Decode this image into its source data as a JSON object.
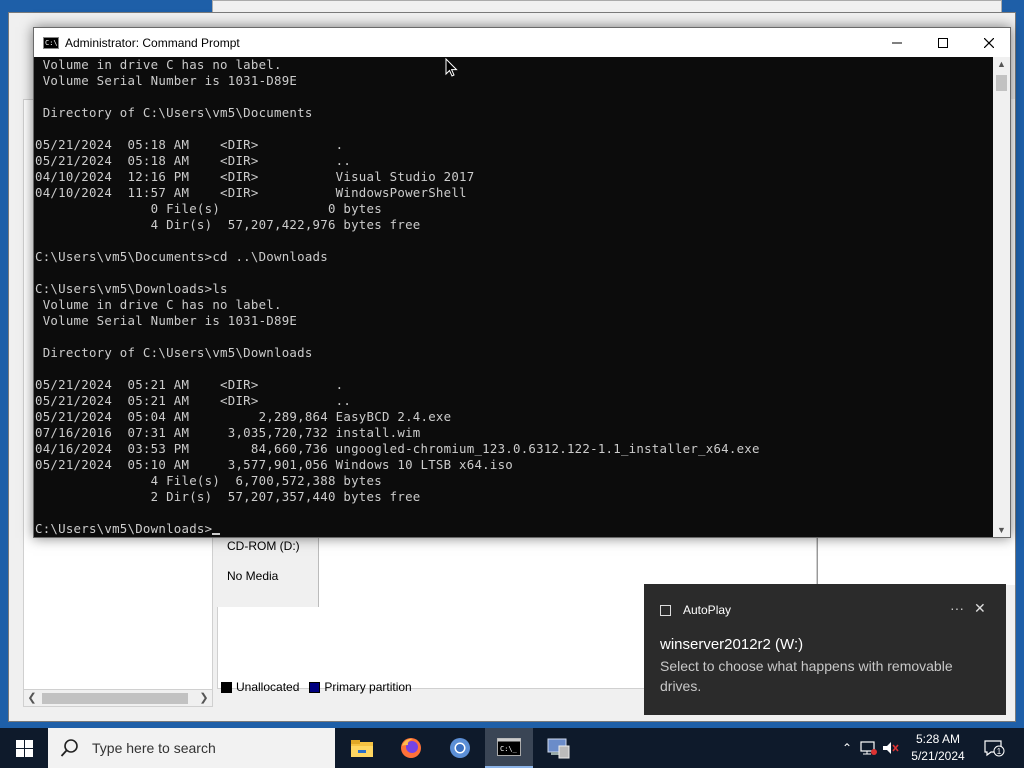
{
  "cmd": {
    "title": "Administrator: Command Prompt",
    "lines": [
      " Volume in drive C has no label.",
      " Volume Serial Number is 1031-D89E",
      "",
      " Directory of C:\\Users\\vm5\\Documents",
      "",
      "05/21/2024  05:18 AM    <DIR>          .",
      "05/21/2024  05:18 AM    <DIR>          ..",
      "04/10/2024  12:16 PM    <DIR>          Visual Studio 2017",
      "04/10/2024  11:57 AM    <DIR>          WindowsPowerShell",
      "               0 File(s)              0 bytes",
      "               4 Dir(s)  57,207,422,976 bytes free",
      "",
      "C:\\Users\\vm5\\Documents>cd ..\\Downloads",
      "",
      "C:\\Users\\vm5\\Downloads>ls",
      " Volume in drive C has no label.",
      " Volume Serial Number is 1031-D89E",
      "",
      " Directory of C:\\Users\\vm5\\Downloads",
      "",
      "05/21/2024  05:21 AM    <DIR>          .",
      "05/21/2024  05:21 AM    <DIR>          ..",
      "05/21/2024  05:04 AM         2,289,864 EasyBCD 2.4.exe",
      "07/16/2016  07:31 AM     3,035,720,732 install.wim",
      "04/16/2024  03:53 PM        84,660,736 ungoogled-chromium_123.0.6312.122-1.1_installer_x64.exe",
      "05/21/2024  05:10 AM     3,577,901,056 Windows 10 LTSB x64.iso",
      "               4 File(s)  6,700,572,388 bytes",
      "               2 Dir(s)  57,207,357,440 bytes free",
      "",
      "C:\\Users\\vm5\\Downloads>"
    ]
  },
  "disk_mgmt": {
    "cdrom_label": "CD-ROM (D:)",
    "no_media": "No Media",
    "legend": [
      {
        "label": "Unallocated",
        "color": "#000000"
      },
      {
        "label": "Primary partition",
        "color": "#000080"
      }
    ]
  },
  "toast": {
    "app": "AutoPlay",
    "title": "winserver2012r2 (W:)",
    "body": "Select to choose what happens with removable drives."
  },
  "taskbar": {
    "search_placeholder": "Type here to search",
    "time": "5:28 AM",
    "date": "5/21/2024",
    "notification_count": "1",
    "apps": [
      "file-explorer",
      "firefox",
      "chromium",
      "command-prompt",
      "server-manager"
    ]
  }
}
